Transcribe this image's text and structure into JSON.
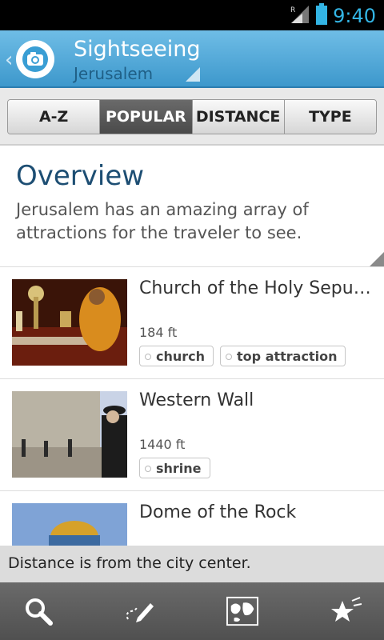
{
  "status": {
    "time": "9:40",
    "signal_icon": "signal-roaming-icon",
    "battery_icon": "battery-icon"
  },
  "header": {
    "title": "Sightseeing",
    "subtitle": "Jerusalem",
    "app_icon": "camera-icon",
    "back_icon": "back-chevron-icon"
  },
  "tabs": [
    {
      "label": "A-Z",
      "active": false
    },
    {
      "label": "POPULAR",
      "active": true
    },
    {
      "label": "DISTANCE",
      "active": false
    },
    {
      "label": "TYPE",
      "active": false
    }
  ],
  "overview": {
    "title": "Overview",
    "text": "Jerusalem has an amazing array of attractions for the traveler to see."
  },
  "items": [
    {
      "name": "Church of the Holy Sepul…",
      "distance": "184 ft",
      "tags": [
        "church",
        "top attraction"
      ]
    },
    {
      "name": "Western Wall",
      "distance": "1440 ft",
      "tags": [
        "shrine"
      ]
    },
    {
      "name": "Dome of the Rock",
      "distance": "",
      "tags": []
    }
  ],
  "info": {
    "text": "Distance is from the city center."
  },
  "bottom_nav": [
    {
      "icon": "search-icon"
    },
    {
      "icon": "edit-route-icon"
    },
    {
      "icon": "map-icon"
    },
    {
      "icon": "favorites-star-icon"
    }
  ],
  "colors": {
    "actionbar": "#4aa6d8",
    "time": "#33b5e5",
    "title_accent": "#1d4e73"
  }
}
